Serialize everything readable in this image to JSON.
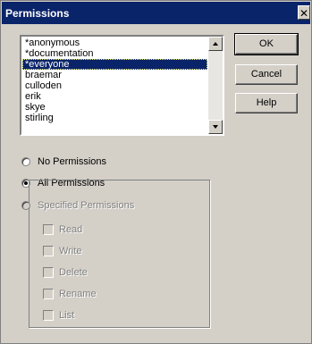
{
  "window": {
    "title": "Permissions",
    "close_glyph": "✕"
  },
  "user_list": {
    "items": [
      "*anonymous",
      "*documentation",
      "*everyone",
      "braemar",
      "culloden",
      "erik",
      "skye",
      "stirling"
    ],
    "selected_index": 2
  },
  "buttons": {
    "ok": "OK",
    "cancel": "Cancel",
    "help": "Help"
  },
  "radios": {
    "no_permissions": "No Permissions",
    "all_permissions": "All Permissions",
    "specified_permissions": "Specified Permissions"
  },
  "checkboxes": [
    "Read",
    "Write",
    "Delete",
    "Rename",
    "List"
  ],
  "colors": {
    "title_bar": "#0a246a",
    "face": "#d4d0c8",
    "disabled_text": "#808080"
  }
}
